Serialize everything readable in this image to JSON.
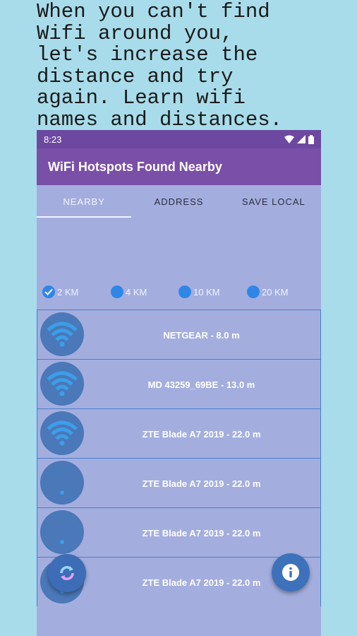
{
  "promo_text": "When you can't find\nWifi around you,\nlet's increase the\ndistance and try\nagain. Learn wifi\nnames and distances.",
  "status_bar": {
    "time": "8:23"
  },
  "app_bar": {
    "title": "WiFi Hotspots Found Nearby"
  },
  "tabs": [
    {
      "label": "NEARBY",
      "active": true
    },
    {
      "label": "ADDRESS",
      "active": false
    },
    {
      "label": "SAVE LOCAL",
      "active": false
    }
  ],
  "radius_options": [
    {
      "label": "2 KM",
      "selected": true
    },
    {
      "label": "4 KM",
      "selected": false
    },
    {
      "label": "10 KM",
      "selected": false
    },
    {
      "label": "20 KM",
      "selected": false
    }
  ],
  "hotspots": [
    {
      "name": "NETGEAR - 8.0 m",
      "signal": "strong"
    },
    {
      "name": "MD 43259_69BE - 13.0 m",
      "signal": "strong"
    },
    {
      "name": "ZTE Blade A7 2019 - 22.0 m",
      "signal": "strong"
    },
    {
      "name": "ZTE Blade A7 2019 - 22.0 m",
      "signal": "weak"
    },
    {
      "name": "ZTE Blade A7 2019 - 22.0 m",
      "signal": "weak"
    },
    {
      "name": "ZTE Blade A7 2019 - 22.0 m",
      "signal": "weak"
    }
  ],
  "icons": {
    "wifi": "wifi-icon",
    "refresh": "refresh-icon",
    "info": "info-icon"
  },
  "colors": {
    "status_bar": "#6d48a0",
    "app_bar": "#7a4fa8",
    "content_bg": "#a3aedf",
    "accent_blue": "#2f86e6",
    "outer_bg": "#a8dcea"
  }
}
